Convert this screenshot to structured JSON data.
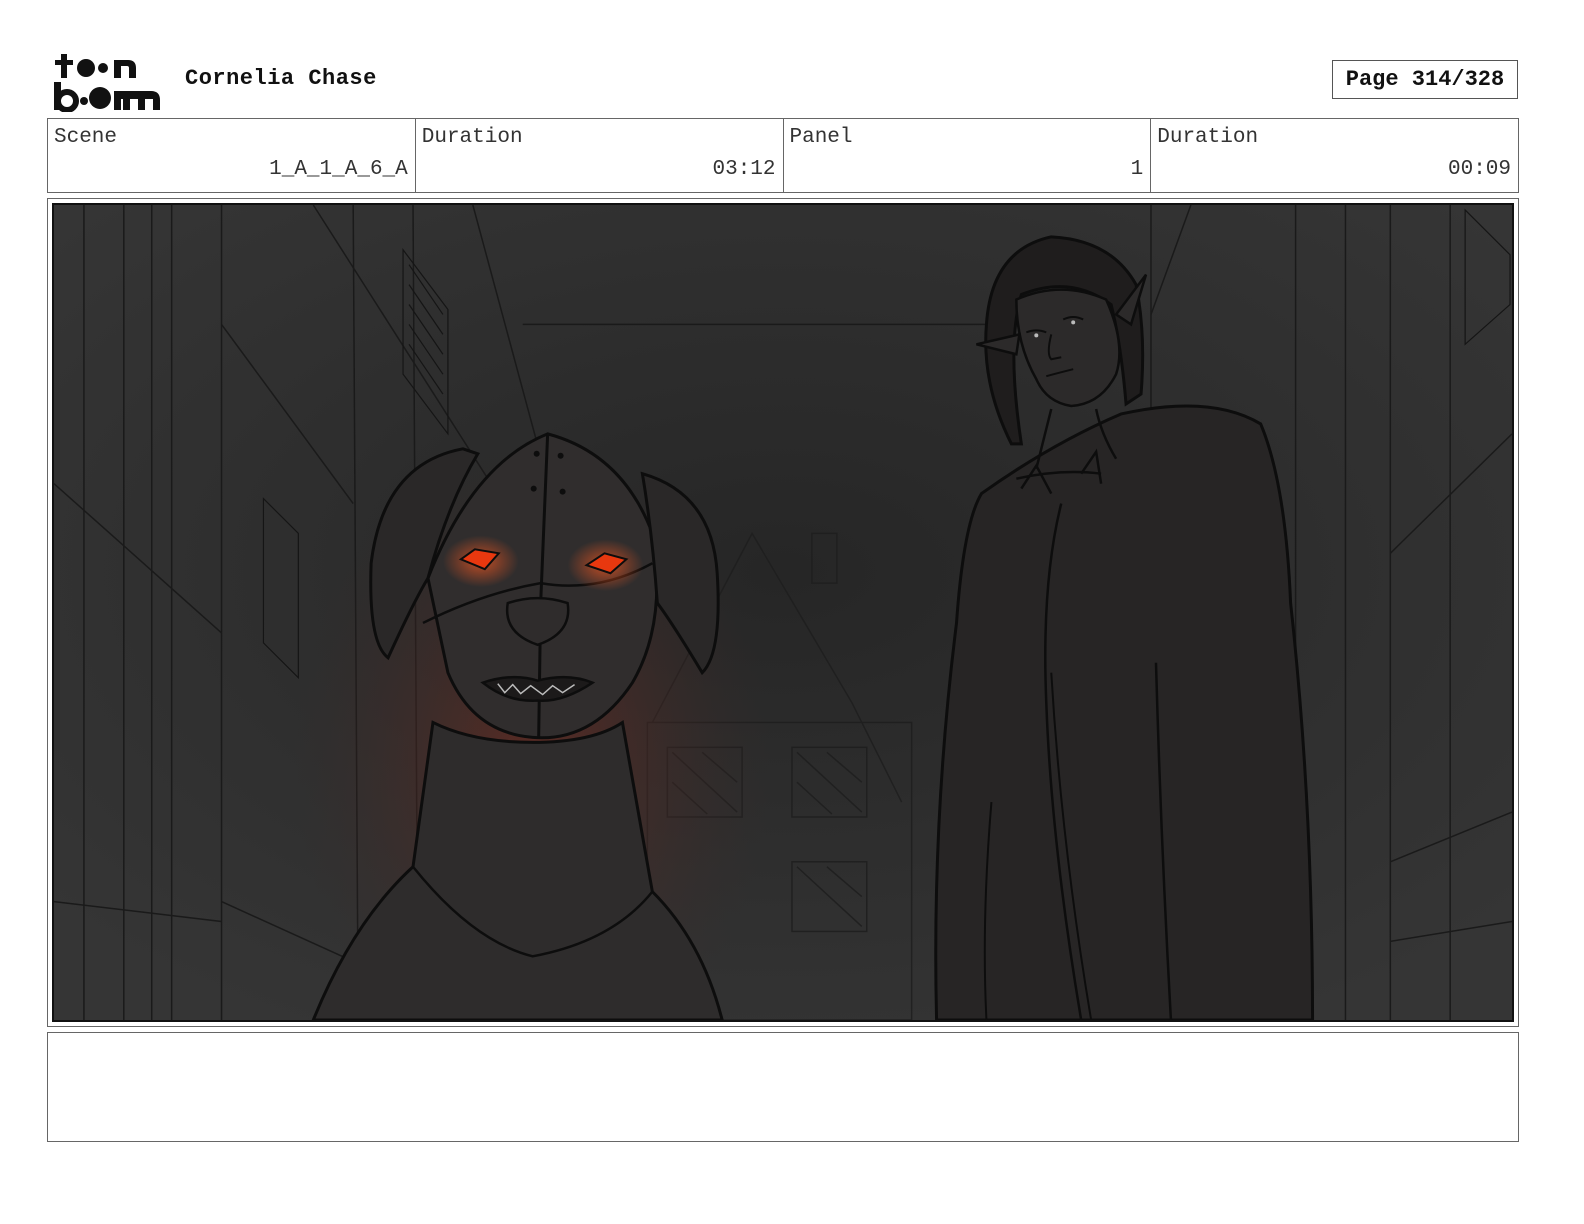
{
  "header": {
    "logo_text": "toonboom",
    "project_title": "Cornelia Chase",
    "page_label": "Page 314/328"
  },
  "info_bar": {
    "scene_label": "Scene",
    "scene_value": "1_A_1_A_6_A",
    "scene_duration_label": "Duration",
    "scene_duration_value": "03:12",
    "panel_label": "Panel",
    "panel_value": "1",
    "panel_duration_label": "Duration",
    "panel_duration_value": "00:09"
  },
  "panel": {
    "colors": {
      "background": "#2b2b2b",
      "line": "#111111",
      "eye_glow": "#e8380f",
      "red_tint": "#5a2a22"
    }
  },
  "notes": {
    "text": ""
  }
}
